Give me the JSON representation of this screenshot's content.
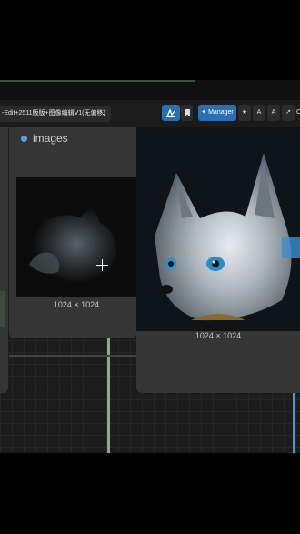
{
  "workflow": {
    "title": "-Edit+2511版版+图像编辑V1(无偏移)",
    "dropdown_icon": "chevron-down-icon"
  },
  "toolbar": {
    "queue_icon": "queue-icon",
    "bookmark_icon": "bookmark-icon",
    "manager_label": "Manager",
    "manager_icon": "puzzle-icon",
    "star_icon": "star-icon",
    "text_a_icon": "text-icon",
    "share_icon": "share-icon",
    "more_label": "C"
  },
  "node_images": {
    "title": "images",
    "dimensions": "1024 × 1024",
    "image_description": "blurry gray fox image"
  },
  "node_output": {
    "dimensions": "1024 × 1024",
    "image_description": "gray fox with blue eyes"
  },
  "colors": {
    "canvas": "#1c1c1c",
    "node": "#353535",
    "accent_blue": "#2a6fb0",
    "dot": "#5aa0e8"
  }
}
